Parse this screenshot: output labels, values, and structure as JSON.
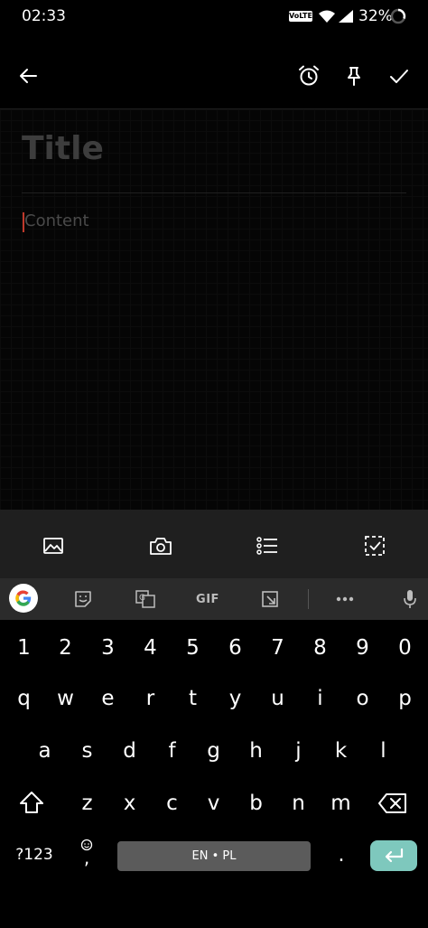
{
  "status_bar": {
    "time": "02:33",
    "network_badge": "VoLTE",
    "battery_percent": "32%",
    "icons": [
      "wifi-icon",
      "signal-icon",
      "battery-icon"
    ]
  },
  "app_bar": {
    "icons": [
      "back-arrow-icon",
      "alarm-icon",
      "pin-icon",
      "check-icon"
    ]
  },
  "editor": {
    "title_placeholder": "Title",
    "content_placeholder": "Content"
  },
  "toolbar": {
    "icons": [
      "image-icon",
      "camera-icon",
      "bulleted-list-icon",
      "checkbox-icon"
    ]
  },
  "keyboard": {
    "strip": {
      "gif_label": "GIF",
      "icons": [
        "google-g-icon",
        "sticker-icon",
        "translate-icon",
        "clipboard-icon",
        "more-icon",
        "mic-icon"
      ]
    },
    "number_row": [
      "1",
      "2",
      "3",
      "4",
      "5",
      "6",
      "7",
      "8",
      "9",
      "0"
    ],
    "row_qwerty": [
      "q",
      "w",
      "e",
      "r",
      "t",
      "y",
      "u",
      "i",
      "o",
      "p"
    ],
    "row_asdf": [
      "a",
      "s",
      "d",
      "f",
      "g",
      "h",
      "j",
      "k",
      "l"
    ],
    "row_zxcv": [
      "z",
      "x",
      "c",
      "v",
      "b",
      "n",
      "m"
    ],
    "symbols_label": "?123",
    "comma_label": ",",
    "space_label": "EN • PL",
    "period_label": ".",
    "enter_color": "#7ec8bd"
  },
  "colors": {
    "background": "#000000",
    "toolbar_bg": "#1f1f1f",
    "strip_bg": "#2b2b2b",
    "cursor": "#c0392b"
  }
}
